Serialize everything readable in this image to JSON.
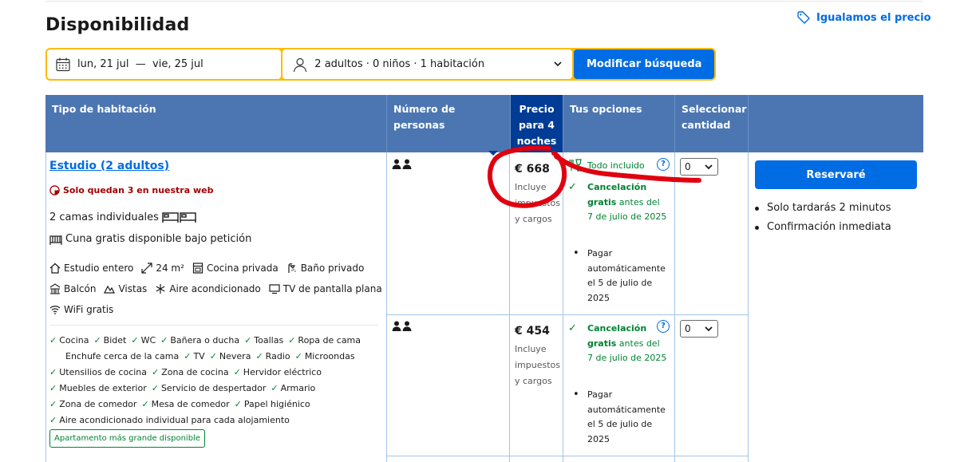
{
  "header": {
    "title": "Disponibilidad",
    "price_match": "Igualamos el precio"
  },
  "search": {
    "dates": "lun, 21 jul  —  vie, 25 jul",
    "guests": "2 adultos · 0 niños · 1 habitación",
    "button": "Modificar búsqueda"
  },
  "table": {
    "headers": {
      "room_type": "Tipo de habitación",
      "persons": "Número de personas",
      "price": "Precio para 4 noches",
      "options": "Tus opciones",
      "select_qty": "Seleccionar cantidad"
    }
  },
  "room": {
    "name": "Estudio (2 adultos)",
    "scarcity": "Solo quedan 3 en nuestra web",
    "beds": "2 camas individuales",
    "crib": "Cuna gratis disponible bajo petición",
    "amenities": [
      "Estudio entero",
      "24 m²",
      "Cocina privada",
      "Baño privado",
      "Balcón",
      "Vistas",
      "Aire acondicionado",
      "TV de pantalla plana",
      "WiFi gratis"
    ],
    "facilities": [
      [
        "Cocina",
        "Bidet",
        "WC",
        "Bañera o ducha",
        "Toallas",
        "Ropa de cama"
      ],
      [
        "Enchufe cerca de la cama",
        "TV",
        "Nevera",
        "Radio",
        "Microondas"
      ],
      [
        "Utensilios de cocina",
        "Zona de cocina",
        "Hervidor eléctrico"
      ],
      [
        "Muebles de exterior",
        "Servicio de despertador",
        "Armario"
      ],
      [
        "Zona de comedor",
        "Mesa de comedor",
        "Papel higiénico"
      ],
      [
        "Aire acondicionado individual para cada alojamiento"
      ]
    ],
    "badge": "Apartamento más grande disponible"
  },
  "offers": [
    {
      "price": "€ 668",
      "price_note": "Incluye impuestos y cargos",
      "all_inclusive": "Todo incluido",
      "cancel_bold": "Cancelación gratis",
      "cancel_rest": " antes del 7 de julio de 2025",
      "pay": "Pagar automáticamente el 5 de julio de 2025",
      "qty": "0"
    },
    {
      "price": "€ 454",
      "price_note": "Incluye impuestos y cargos",
      "cancel_bold": "Cancelación gratis",
      "cancel_rest": " antes del 7 de julio de 2025",
      "pay": "Pagar automáticamente el 5 de julio de 2025",
      "qty": "0"
    }
  ],
  "reserve": {
    "button": "Reservaré",
    "bullets": [
      "Solo tardarás 2 minutos",
      "Confirmación inmediata"
    ]
  },
  "colors": {
    "brand_blue": "#006ce4",
    "header_blue": "#4c76b2",
    "dark_blue": "#003b95",
    "yellow": "#febb02",
    "green": "#008234",
    "red_annotation": "#e0000f"
  }
}
